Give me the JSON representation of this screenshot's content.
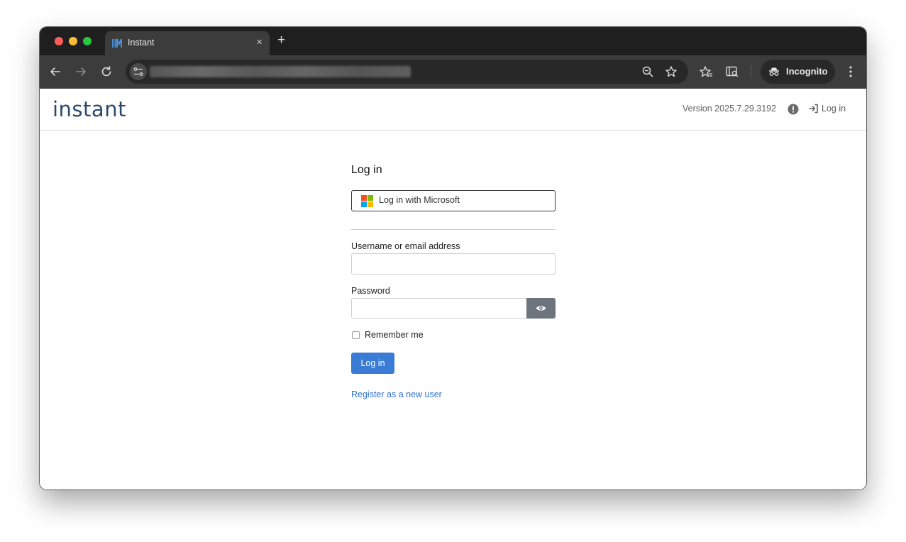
{
  "browser": {
    "tab_title": "Instant",
    "tab_close": "×",
    "new_tab": "+",
    "url_redacted": "redacted",
    "profile_label": "Incognito"
  },
  "header": {
    "logo_text": "instant",
    "version_text": "Version 2025.7.29.3192",
    "login_link": "Log in"
  },
  "login_form": {
    "title": "Log in",
    "microsoft_button": "Log in with Microsoft",
    "username_label": "Username or email address",
    "username_value": "",
    "password_label": "Password",
    "password_value": "",
    "remember_label": "Remember me",
    "remember_checked": false,
    "submit_label": "Log in",
    "register_link": "Register as a new user"
  },
  "icons": {
    "back": "arrow-left-icon",
    "forward": "arrow-right-icon",
    "reload": "reload-icon",
    "site_info": "tune-icon",
    "zoom": "zoom-out-icon",
    "bookmark": "star-icon",
    "bookmarks_bar": "star-list-icon",
    "reading_mode": "search-panel-icon",
    "incognito": "incognito-icon",
    "menu": "kebab-icon",
    "alert": "exclamation-circle-icon",
    "login": "sign-in-icon",
    "show_password": "eye-icon"
  },
  "colors": {
    "brand": "#2b4a6b",
    "primary": "#3a7bd5",
    "link": "#2f6fce",
    "secondary_button": "#6c757d",
    "ms_red": "#f25022",
    "ms_green": "#7fba00",
    "ms_blue": "#00a4ef",
    "ms_yellow": "#ffb900"
  }
}
